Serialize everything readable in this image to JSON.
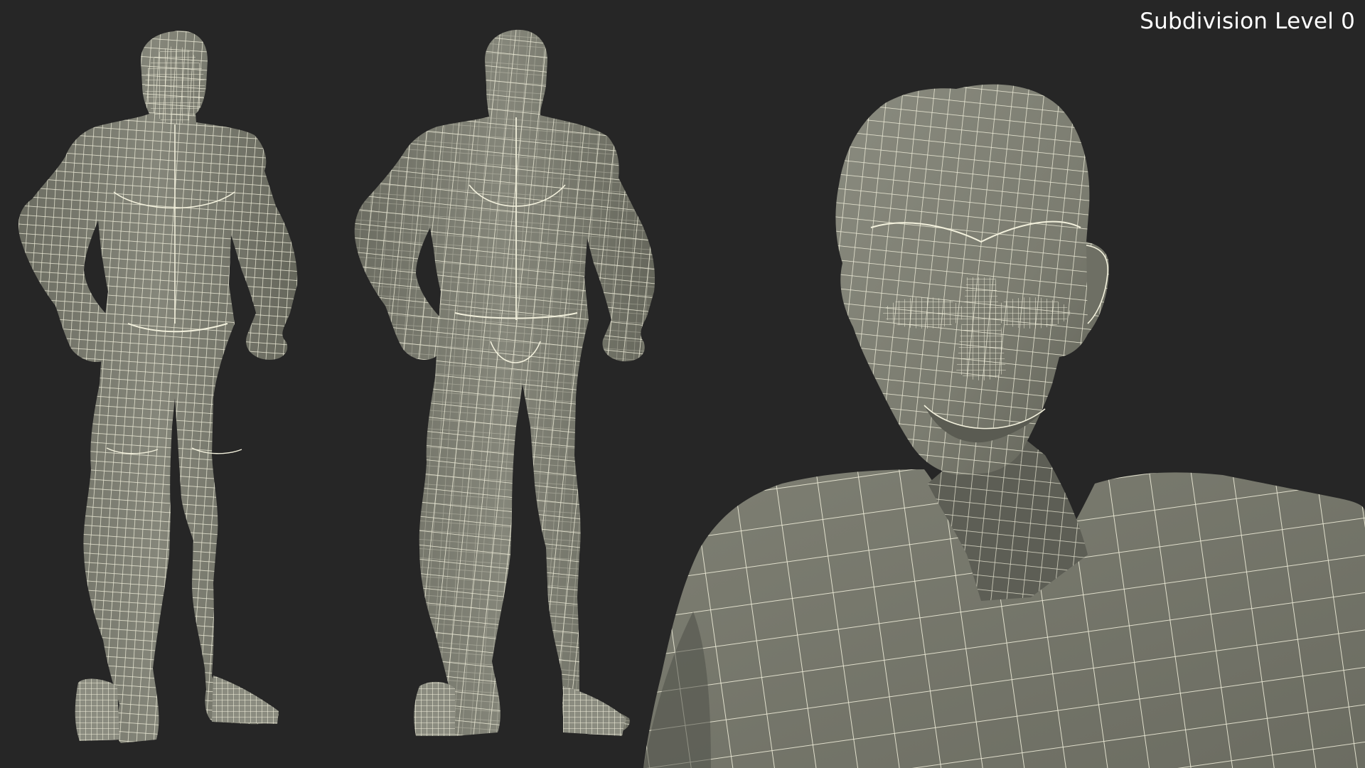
{
  "overlay": {
    "subdivision_label": "Subdivision Level 0"
  },
  "views": [
    {
      "name": "front-view-full-body"
    },
    {
      "name": "back-view-full-body"
    },
    {
      "name": "closeup-head-and-shoulders"
    }
  ],
  "colors": {
    "background": "#262626",
    "mesh_surface": "#7d7e72",
    "mesh_shadow": "#55564d",
    "wireframe": "#f3f1dd"
  }
}
